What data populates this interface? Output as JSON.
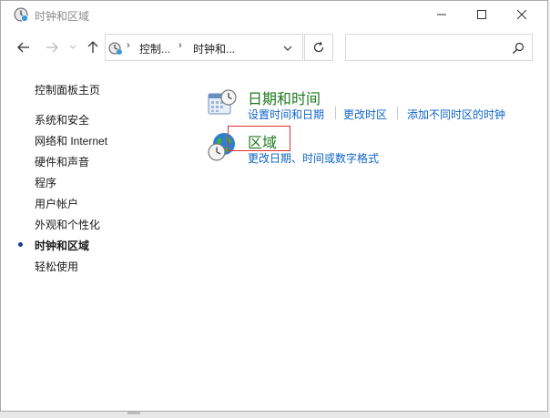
{
  "window": {
    "title": "时钟和区域",
    "icon": "clock-globe-icon",
    "controls": {
      "minimize": "minimize-icon",
      "maximize": "maximize-icon",
      "close": "close-icon"
    }
  },
  "address_bar": {
    "breadcrumbs": [
      "控制...",
      "时钟和..."
    ],
    "icon": "control-panel-icon"
  },
  "search": {
    "value": "",
    "placeholder": "",
    "icon": "search-icon"
  },
  "sidebar": {
    "items": [
      {
        "label": "控制面板主页",
        "current": false
      },
      {
        "label": "系统和安全",
        "current": false
      },
      {
        "label": "网络和 Internet",
        "current": false
      },
      {
        "label": "硬件和声音",
        "current": false
      },
      {
        "label": "程序",
        "current": false
      },
      {
        "label": "用户帐户",
        "current": false
      },
      {
        "label": "外观和个性化",
        "current": false
      },
      {
        "label": "时钟和区域",
        "current": true
      },
      {
        "label": "轻松使用",
        "current": false
      }
    ]
  },
  "main": {
    "categories": [
      {
        "title": "日期和时间",
        "icon": "calendar-clock-icon",
        "links": [
          "设置时间和日期",
          "更改时区",
          "添加不同时区的时钟"
        ]
      },
      {
        "title": "区域",
        "icon": "globe-clock-icon",
        "links": [
          "更改日期、时间或数字格式"
        ]
      }
    ]
  },
  "colors": {
    "category_title": "#1e7a1e",
    "link": "#0f64c8",
    "highlight_box": "#e03030",
    "current_bullet": "#1a3d8c"
  }
}
